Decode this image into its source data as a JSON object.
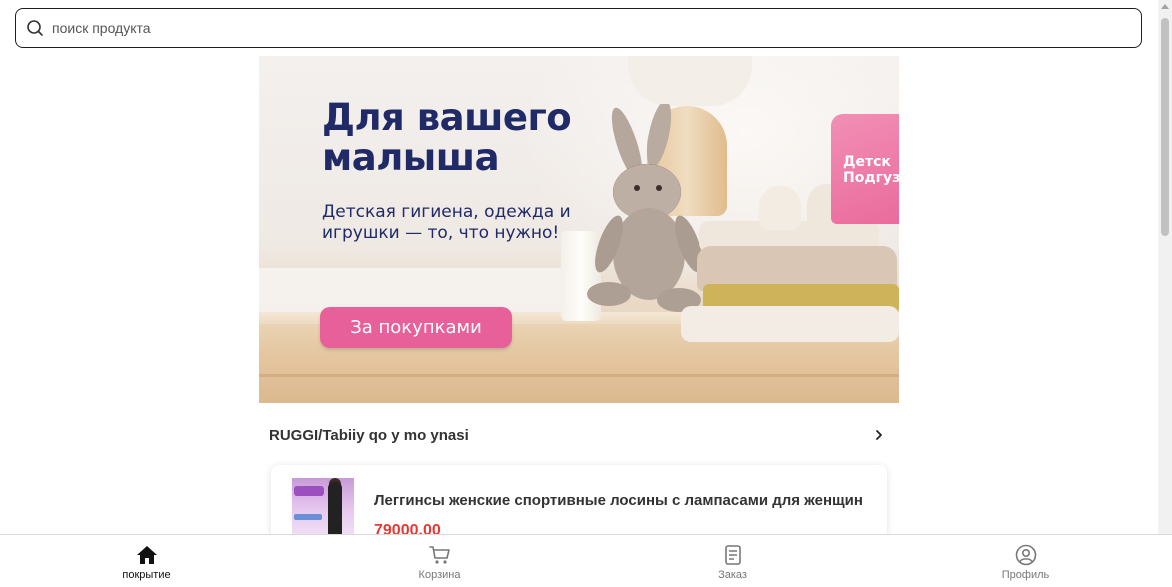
{
  "search": {
    "placeholder": "поиск продукта",
    "icon": "search-icon"
  },
  "banner": {
    "title": "Для вашего малыша",
    "subtitle": "Детская гигиена, одежда и игрушки — то, что нужно!",
    "cta_label": "За покупками",
    "diaper_text": "Детск Подгуз",
    "colors": {
      "title": "#1f2a66",
      "cta": "#e8609a"
    }
  },
  "section": {
    "title": "RUGGI/Tabiiy qo y mo ynasi",
    "chevron_icon": "chevron-right-icon"
  },
  "products": [
    {
      "name": "Леггинсы женские спортивные лосины с лампасами для женщин",
      "price": "79000.00"
    }
  ],
  "bottom_nav": {
    "items": [
      {
        "label": "покрытие",
        "icon": "home-icon",
        "active": true
      },
      {
        "label": "Корзина",
        "icon": "cart-icon",
        "active": false
      },
      {
        "label": "Заказ",
        "icon": "order-icon",
        "active": false
      },
      {
        "label": "Профиль",
        "icon": "profile-icon",
        "active": false
      }
    ]
  },
  "colors": {
    "price": "#e53935",
    "nav_active": "#111111",
    "nav_inactive": "#777777"
  }
}
